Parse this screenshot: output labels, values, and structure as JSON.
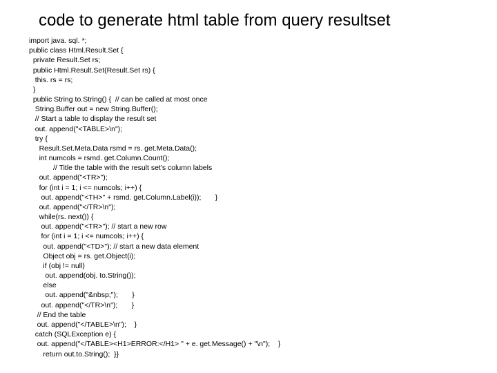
{
  "title": "code to generate html table from query resultset",
  "code": "import java. sql. *;\npublic class Html.Result.Set {\n  private Result.Set rs;\n  public Html.Result.Set(Result.Set rs) {\n   this. rs = rs;\n  }\n  public String to.String() {  // can be called at most once\n   String.Buffer out = new String.Buffer();\n   // Start a table to display the result set\n   out. append(\"<TABLE>\\n\");\n   try {\n     Result.Set.Meta.Data rsmd = rs. get.Meta.Data();\n     int numcols = rsmd. get.Column.Count();\n            // Title the table with the result set's column labels\n     out. append(\"<TR>\");\n     for (int i = 1; i <= numcols; i++) {\n      out. append(\"<TH>\" + rsmd. get.Column.Label(i));       }\n     out. append(\"</TR>\\n\");\n     while(rs. next()) {\n      out. append(\"<TR>\"); // start a new row\n      for (int i = 1; i <= numcols; i++) {\n       out. append(\"<TD>\"); // start a new data element\n       Object obj = rs. get.Object(i);\n       if (obj != null)\n        out. append(obj. to.String());\n       else\n        out. append(\"&nbsp;\");       }\n      out. append(\"</TR>\\n\");       }\n    // End the table\n    out. append(\"</TABLE>\\n\");    }\n   catch (SQLException e) {\n    out. append(\"</TABLE><H1>ERROR:</H1> \" + e. get.Message() + \"\\n\");    }\n       return out.to.String();  }}"
}
